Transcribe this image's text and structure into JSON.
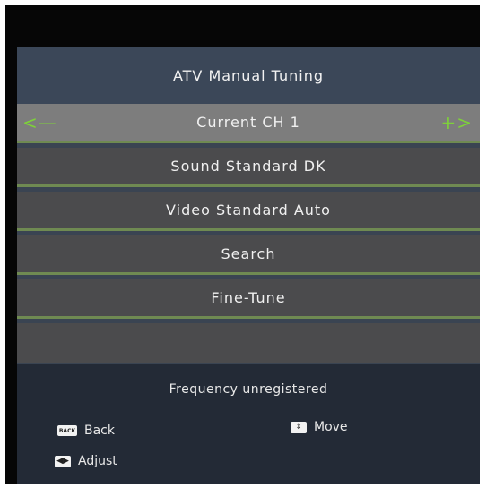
{
  "menu": {
    "title": "ATV Manual Tuning",
    "items": [
      {
        "label": "Current CH 1",
        "selected": true
      },
      {
        "label": "Sound Standard DK",
        "selected": false
      },
      {
        "label": "Video Standard Auto",
        "selected": false
      },
      {
        "label": "Search",
        "selected": false
      },
      {
        "label": "Fine-Tune",
        "selected": false
      },
      {
        "label": "",
        "selected": false
      }
    ],
    "left_arrow": "<—",
    "right_arrow": "+>"
  },
  "footer": {
    "status": "Frequency unregistered",
    "hints": [
      {
        "key": "BACK",
        "label": "Back"
      },
      {
        "key": "⇕",
        "label": "Move"
      },
      {
        "key": "◀▶",
        "label": "Adjust"
      }
    ]
  },
  "colors": {
    "accent": "#7ed13a",
    "panel": "#3b4758",
    "row": "#4b4b4d",
    "selected_row": "#7d7d7d",
    "footer": "#232a36"
  }
}
